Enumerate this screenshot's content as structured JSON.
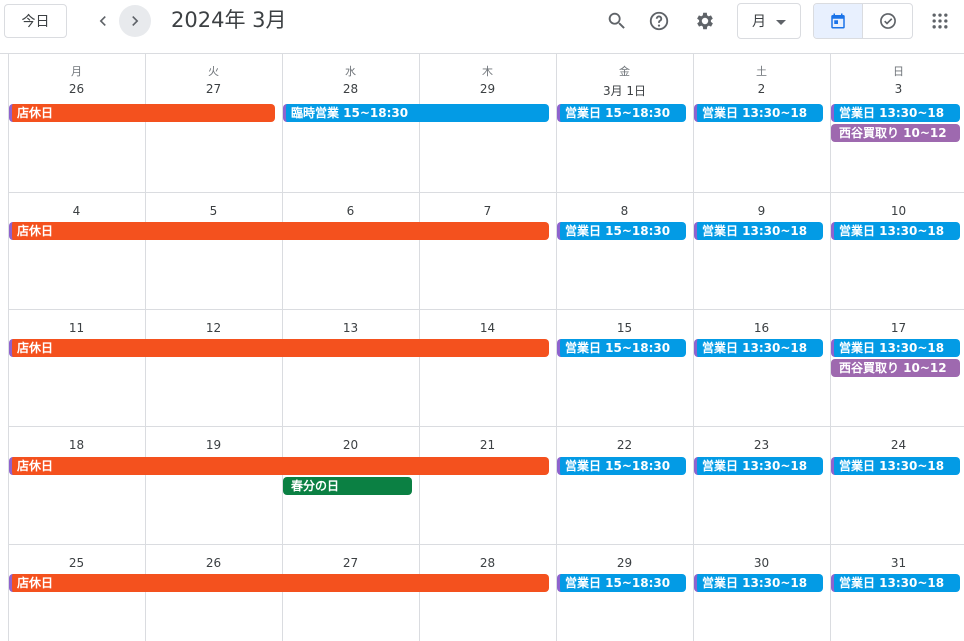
{
  "header": {
    "today_label": "今日",
    "month_title": "2024年 3月",
    "view_label": "月",
    "icons": [
      "chevron-left-icon",
      "chevron-right-icon",
      "search-icon",
      "help-icon",
      "gear-icon",
      "calendar-icon",
      "task-icon",
      "apps-icon"
    ]
  },
  "colors": {
    "closed": "#f4511e",
    "open": "#039be5",
    "purple": "#9e69af",
    "holiday": "#0b8043",
    "accent": "#1a73e8"
  },
  "weekdays": [
    "月",
    "火",
    "水",
    "木",
    "金",
    "土",
    "日"
  ],
  "weeks": [
    [
      "26",
      "27",
      "28",
      "29",
      "3月 1日",
      "2",
      "3"
    ],
    [
      "4",
      "5",
      "6",
      "7",
      "8",
      "9",
      "10"
    ],
    [
      "11",
      "12",
      "13",
      "14",
      "15",
      "16",
      "17"
    ],
    [
      "18",
      "19",
      "20",
      "21",
      "22",
      "23",
      "24"
    ],
    [
      "25",
      "26",
      "27",
      "28",
      "29",
      "30",
      "31"
    ]
  ],
  "events": [
    {
      "week": 0,
      "start": 0,
      "span": 2,
      "slot": 0,
      "text": "店休日",
      "color": "closed"
    },
    {
      "week": 0,
      "start": 2,
      "span": 2,
      "slot": 0,
      "text": "臨時営業 15~18:30",
      "color": "open"
    },
    {
      "week": 0,
      "start": 4,
      "span": 1,
      "slot": 0,
      "text": "営業日 15~18:30",
      "color": "open"
    },
    {
      "week": 0,
      "start": 5,
      "span": 1,
      "slot": 0,
      "text": "営業日 13:30~18",
      "color": "open"
    },
    {
      "week": 0,
      "start": 6,
      "span": 1,
      "slot": 0,
      "text": "営業日 13:30~18",
      "color": "open"
    },
    {
      "week": 0,
      "start": 6,
      "span": 1,
      "slot": 1,
      "text": "西谷買取り 10~12",
      "color": "purple"
    },
    {
      "week": 1,
      "start": 0,
      "span": 4,
      "slot": 0,
      "text": "店休日",
      "color": "closed"
    },
    {
      "week": 1,
      "start": 4,
      "span": 1,
      "slot": 0,
      "text": "営業日 15~18:30",
      "color": "open"
    },
    {
      "week": 1,
      "start": 5,
      "span": 1,
      "slot": 0,
      "text": "営業日 13:30~18",
      "color": "open"
    },
    {
      "week": 1,
      "start": 6,
      "span": 1,
      "slot": 0,
      "text": "営業日 13:30~18",
      "color": "open"
    },
    {
      "week": 2,
      "start": 0,
      "span": 4,
      "slot": 0,
      "text": "店休日",
      "color": "closed"
    },
    {
      "week": 2,
      "start": 4,
      "span": 1,
      "slot": 0,
      "text": "営業日 15~18:30",
      "color": "open"
    },
    {
      "week": 2,
      "start": 5,
      "span": 1,
      "slot": 0,
      "text": "営業日 13:30~18",
      "color": "open"
    },
    {
      "week": 2,
      "start": 6,
      "span": 1,
      "slot": 0,
      "text": "営業日 13:30~18",
      "color": "open"
    },
    {
      "week": 2,
      "start": 6,
      "span": 1,
      "slot": 1,
      "text": "西谷買取り 10~12",
      "color": "purple"
    },
    {
      "week": 3,
      "start": 0,
      "span": 4,
      "slot": 0,
      "text": "店休日",
      "color": "closed"
    },
    {
      "week": 3,
      "start": 2,
      "span": 1,
      "slot": 1,
      "text": "春分の日",
      "color": "holiday"
    },
    {
      "week": 3,
      "start": 4,
      "span": 1,
      "slot": 0,
      "text": "営業日 15~18:30",
      "color": "open"
    },
    {
      "week": 3,
      "start": 5,
      "span": 1,
      "slot": 0,
      "text": "営業日 13:30~18",
      "color": "open"
    },
    {
      "week": 3,
      "start": 6,
      "span": 1,
      "slot": 0,
      "text": "営業日 13:30~18",
      "color": "open"
    },
    {
      "week": 4,
      "start": 0,
      "span": 4,
      "slot": 0,
      "text": "店休日",
      "color": "closed"
    },
    {
      "week": 4,
      "start": 4,
      "span": 1,
      "slot": 0,
      "text": "営業日 15~18:30",
      "color": "open"
    },
    {
      "week": 4,
      "start": 5,
      "span": 1,
      "slot": 0,
      "text": "営業日 13:30~18",
      "color": "open"
    },
    {
      "week": 4,
      "start": 6,
      "span": 1,
      "slot": 0,
      "text": "営業日 13:30~18",
      "color": "open"
    }
  ]
}
